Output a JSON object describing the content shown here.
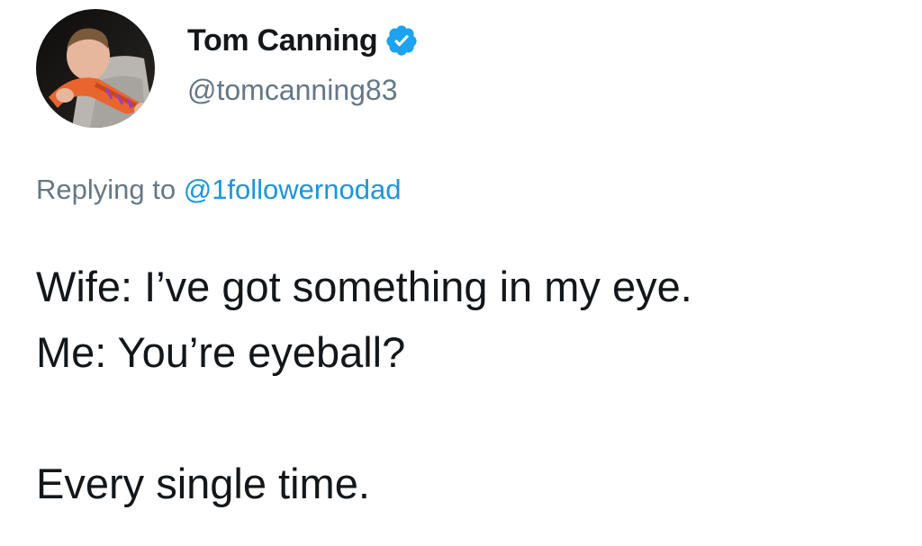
{
  "author": {
    "display_name": "Tom Canning",
    "handle": "@tomcanning83",
    "verified": true,
    "avatar_icon": "profile-photo"
  },
  "reply": {
    "prefix": "Replying to",
    "mention": "@1followernodad"
  },
  "tweet": {
    "lines": [
      "Wife: I’ve got something in my eye.",
      "Me: You’re eyeball?",
      "",
      "Every single time."
    ]
  },
  "colors": {
    "text_primary": "#14171a",
    "text_secondary": "#657786",
    "link": "#1b95e0",
    "verified_badge": "#1da1f2"
  }
}
